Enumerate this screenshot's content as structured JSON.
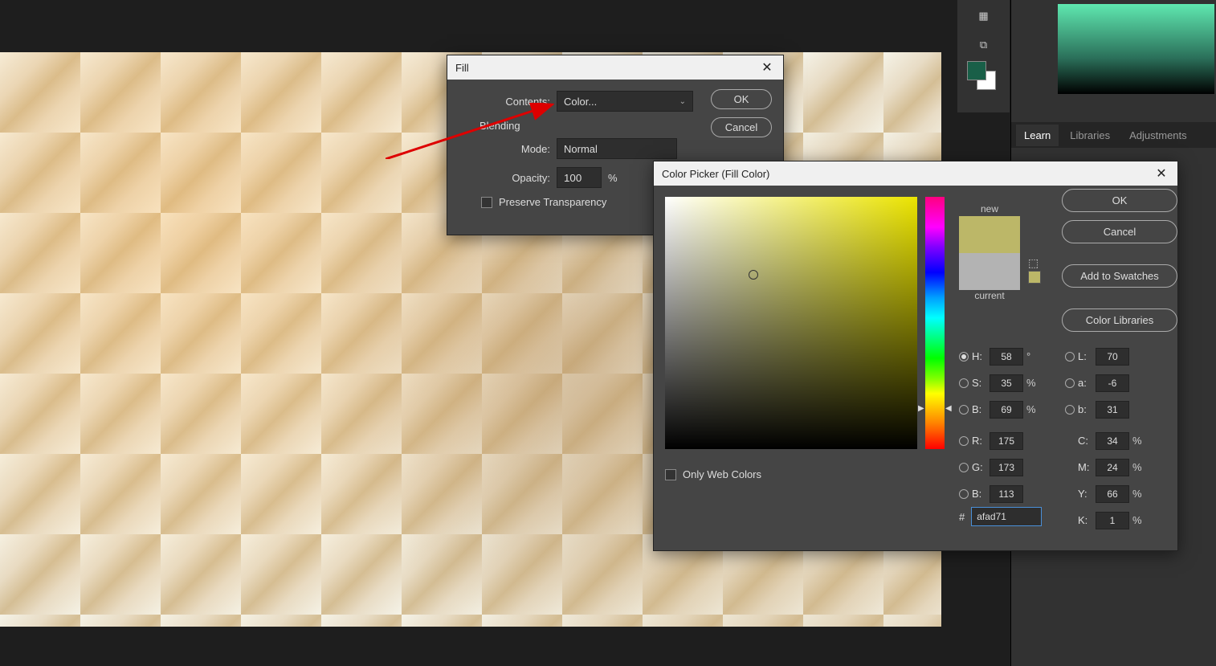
{
  "canvas": {
    "desc": "crumpled paper texture"
  },
  "tool_icons": [
    "3d-icon",
    "swatch-icon"
  ],
  "fgbg": {
    "fg": "#195f48",
    "bg": "#ffffff"
  },
  "panel_tabs": {
    "items": [
      "Learn",
      "Libraries",
      "Adjustments"
    ],
    "active": 0
  },
  "fill": {
    "title": "Fill",
    "contents_label": "Contents:",
    "contents_value": "Color...",
    "blending_label": "Blending",
    "mode_label": "Mode:",
    "mode_value": "Normal",
    "opacity_label": "Opacity:",
    "opacity_value": "100",
    "opacity_unit": "%",
    "preserve_label": "Preserve Transparency",
    "ok": "OK",
    "cancel": "Cancel"
  },
  "picker": {
    "title": "Color Picker (Fill Color)",
    "new_label": "new",
    "current_label": "current",
    "new_color": "#bcb768",
    "current_color": "#b3b3b3",
    "buttons": {
      "ok": "OK",
      "cancel": "Cancel",
      "add": "Add to Swatches",
      "lib": "Color Libraries"
    },
    "fields": {
      "H": "58",
      "S": "35",
      "B": "69",
      "L": "70",
      "a": "-6",
      "b": "31",
      "R": "175",
      "G": "173",
      "Bl": "113",
      "C": "34",
      "M": "24",
      "Y": "66",
      "K": "1"
    },
    "hex_label": "#",
    "hex": "afad71",
    "owc": "Only Web Colors",
    "deg": "°",
    "pct": "%"
  }
}
